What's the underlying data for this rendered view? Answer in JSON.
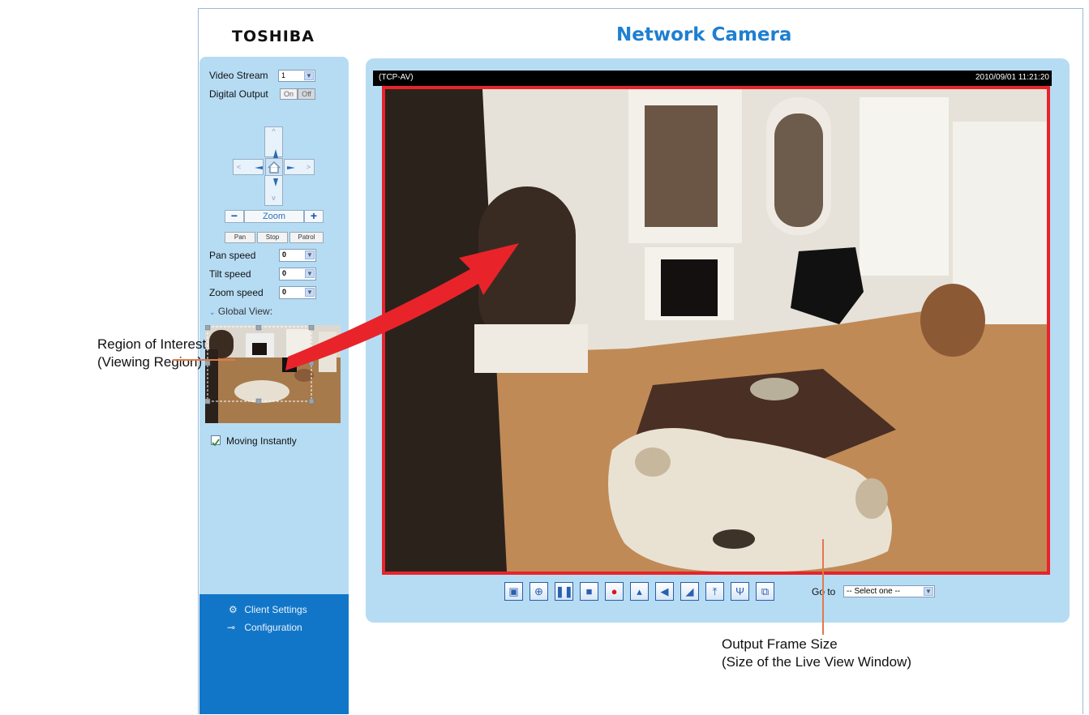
{
  "header": {
    "brand": "TOSHIBA",
    "title": "Network Camera"
  },
  "sidebar": {
    "video_stream_label": "Video Stream",
    "video_stream_value": "1",
    "digital_output_label": "Digital Output",
    "digital_on": "On",
    "digital_off": "Off",
    "zoom_label": "Zoom",
    "zoom_minus": "−",
    "zoom_plus": "+",
    "ptz_up": "^",
    "ptz_down": "v",
    "ptz_left": "<",
    "ptz_right": ">",
    "pan_button": "Pan",
    "stop_button": "Stop",
    "patrol_button": "Patrol",
    "pan_speed_label": "Pan speed",
    "pan_speed_value": "0",
    "tilt_speed_label": "Tilt speed",
    "tilt_speed_value": "0",
    "zoom_speed_label": "Zoom speed",
    "zoom_speed_value": "0",
    "global_view_label": "Global View:",
    "moving_instantly_label": "Moving Instantly",
    "moving_instantly_checked": true,
    "client_settings": "Client Settings",
    "configuration": "Configuration"
  },
  "viewer": {
    "protocol": "(TCP-AV)",
    "timestamp": "2010/09/01 11:21:20",
    "goto_label": "Go to",
    "goto_value": "-- Select one --"
  },
  "toolbar": {
    "icons": [
      "snapshot-icon",
      "digital-zoom-icon",
      "pause-icon",
      "stop-icon",
      "record-icon",
      "volume-icon",
      "mute-icon",
      "talk-icon",
      "upload-icon",
      "microphone-icon",
      "fullscreen-icon"
    ]
  },
  "annotations": {
    "roi_line1": "Region of Interest",
    "roi_line2": "(Viewing Region)",
    "frame_line1": "Output Frame Size",
    "frame_line2": "(Size of the Live View Window)"
  },
  "colors": {
    "accent": "#1f7fd0",
    "sidebar_bg": "#b6dcf4",
    "sidebar_bottom": "#1276c8",
    "frame_border": "#e8242a",
    "arrow": "#e8242a"
  }
}
